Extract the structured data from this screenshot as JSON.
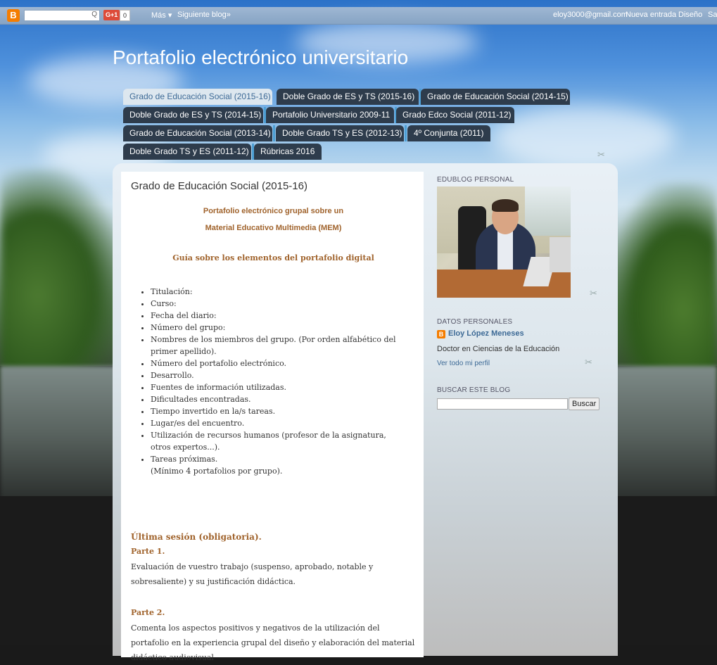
{
  "navbar": {
    "logo": "B",
    "search_icon": "search-icon",
    "gplus": "G+1",
    "gplus_count": "0",
    "mas": "Más ▾",
    "siguiente": "Siguiente blog»",
    "email": "eloy3000@gmail.com",
    "nueva": "Nueva entrada",
    "diseno": "Diseño",
    "salir": "Sa"
  },
  "blog": {
    "title": "Portafolio electrónico universitario"
  },
  "tabs": [
    "Grado de Educación Social (2015-16)",
    "Doble Grado de ES y TS (2015-16)",
    "Grado de Educación Social (2014-15)",
    "Doble Grado de ES y TS (2014-15)",
    "Portafolio Universitario 2009-11",
    "Grado Edco Social (2011-12)",
    "Grado de Educación Social (2013-14)",
    "Doble Grado TS y ES (2012-13)",
    "4º Conjunta (2011)",
    "Doble Grado TS y ES (2011-12)",
    "Rúbricas 2016"
  ],
  "post": {
    "title": "Grado de Educación Social (2015-16)",
    "heading1": "Portafolio electrónico grupal sobre un",
    "heading2": "Material Educativo Multimedia (MEM)",
    "guide": "Guía sobre los elementos del portafolio digital",
    "items": [
      "Titulación:",
      "Curso:",
      "Fecha del diario:",
      "Número del grupo:",
      "Nombres de los miembros del grupo. (Por orden alfabético del primer apellido).",
      "Número del portafolio electrónico.",
      "Desarrollo.",
      "Fuentes de información utilizadas.",
      "Dificultades encontradas.",
      "Tiempo invertido en la/s tareas.",
      "Lugar/es del encuentro.",
      "Utilización de recursos humanos (profesor de la asignatura, otros expertos...).",
      "Tareas próximas."
    ],
    "minimo": "(Mínimo 4 portafolios por grupo).",
    "ultima": "Última sesión (obligatoria).",
    "parte1": "Parte 1.",
    "parte1_text": "Evaluación de vuestro trabajo (suspenso, aprobado, notable y sobresaliente) y su justificación didáctica.",
    "parte2": "Parte 2.",
    "parte2_text": "Comenta los aspectos positivos y negativos de la utilización del portafolio en la experiencia grupal del diseño y elaboración del material didáctico audiovisual"
  },
  "sidebar": {
    "edublog_title": "EDUBLOG PERSONAL",
    "datos_title": "DATOS PERSONALES",
    "name": "Eloy López Meneses",
    "desc": "Doctor en Ciencias de la Educación",
    "perfil": "Ver todo mi perfil",
    "buscar_title": "BUSCAR ESTE BLOG",
    "buscar_btn": "Buscar"
  }
}
